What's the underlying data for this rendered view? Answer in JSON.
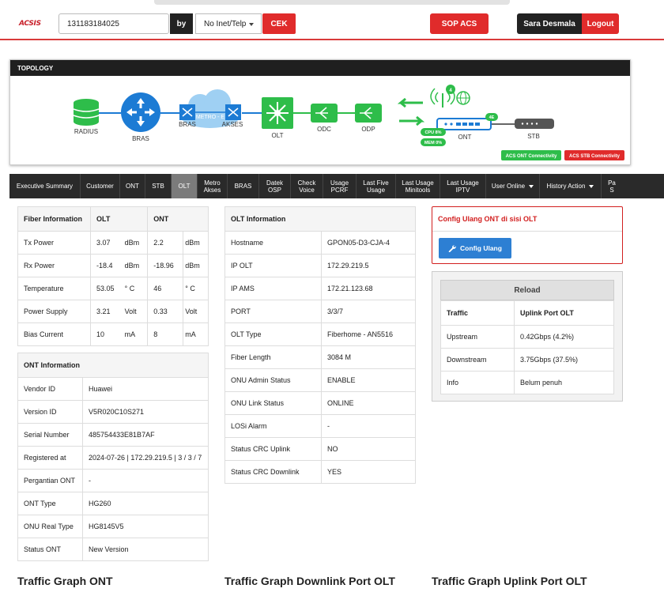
{
  "header": {
    "logo_text": "ACSIS",
    "search_value": "131183184025",
    "by_label": "by",
    "select_value": "No Inet/Telp",
    "cek_label": "CEK",
    "sop_label": "SOP ACS",
    "user_name": "Sara Desmala",
    "logout_label": "Logout"
  },
  "topology": {
    "title": "TOPOLOGY",
    "nodes": {
      "radius": "RADIUS",
      "bras": "BRAS",
      "bras2": "BRAS",
      "metro": "METRO - E",
      "akses": "AKSES",
      "olt": "OLT",
      "odc": "ODC",
      "odp": "ODP",
      "ont": "ONT",
      "stb": "STB"
    },
    "badges": {
      "wifi_count": "4",
      "ont_port": "4E",
      "cpu": "CPU 8%",
      "mem": "MEM 0%",
      "acs_ont": "ACS ONT Connectivity",
      "acs_stb": "ACS STB Connectivity"
    },
    "colors": {
      "green": "#2ebd4a",
      "blue": "#1c7bd4",
      "red": "#e02b2b"
    }
  },
  "tabs": [
    {
      "label": "Executive Summary"
    },
    {
      "label": "Customer"
    },
    {
      "label": "ONT"
    },
    {
      "label": "STB"
    },
    {
      "label": "OLT"
    },
    {
      "label": "Metro Akses"
    },
    {
      "label": "BRAS"
    },
    {
      "label": "Datek OSP"
    },
    {
      "label": "Check Voice"
    },
    {
      "label": "Usage PCRF"
    },
    {
      "label": "Last Five Usage"
    },
    {
      "label": "Last Usage Minitools"
    },
    {
      "label": "Last Usage IPTV"
    },
    {
      "label": "User Online"
    },
    {
      "label": "History Action"
    },
    {
      "label": "Pa S"
    }
  ],
  "fiber": {
    "headers": [
      "Fiber Information",
      "OLT",
      "ONT"
    ],
    "rows": [
      {
        "label": "Tx Power",
        "olt": "3.07",
        "olt_unit": "dBm",
        "ont": "2.2",
        "ont_unit": "dBm"
      },
      {
        "label": "Rx Power",
        "olt": "-18.4",
        "olt_unit": "dBm",
        "ont": "-18.96",
        "ont_unit": "dBm"
      },
      {
        "label": "Temperature",
        "olt": "53.05",
        "olt_unit": "° C",
        "ont": "46",
        "ont_unit": "° C"
      },
      {
        "label": "Power Supply",
        "olt": "3.21",
        "olt_unit": "Volt",
        "ont": "0.33",
        "ont_unit": "Volt"
      },
      {
        "label": "Bias Current",
        "olt": "10",
        "olt_unit": "mA",
        "ont": "8",
        "ont_unit": "mA"
      }
    ]
  },
  "ont_info": {
    "title": "ONT Information",
    "rows": [
      {
        "label": "Vendor ID",
        "value": "Huawei"
      },
      {
        "label": "Version ID",
        "value": "V5R020C10S271"
      },
      {
        "label": "Serial Number",
        "value": "485754433E81B7AF"
      },
      {
        "label": "Registered at",
        "value": "2024-07-26 | 172.29.219.5 | 3 / 3 / 7"
      },
      {
        "label": "Pergantian ONT",
        "value": "-"
      },
      {
        "label": "ONT Type",
        "value": "HG260"
      },
      {
        "label": "ONU Real Type",
        "value": "HG8145V5"
      },
      {
        "label": "Status ONT",
        "value": "New Version"
      }
    ]
  },
  "olt_info": {
    "title": "OLT Information",
    "rows": [
      {
        "label": "Hostname",
        "value": "GPON05-D3-CJA-4"
      },
      {
        "label": "IP OLT",
        "value": "172.29.219.5"
      },
      {
        "label": "IP AMS",
        "value": "172.21.123.68"
      },
      {
        "label": "PORT",
        "value": "3/3/7"
      },
      {
        "label": "OLT Type",
        "value": "Fiberhome - AN5516"
      },
      {
        "label": "Fiber Length",
        "value": "3084 M"
      },
      {
        "label": "ONU Admin Status",
        "value": "ENABLE"
      },
      {
        "label": "ONU Link Status",
        "value": "ONLINE"
      },
      {
        "label": "LOSi Alarm",
        "value": "-"
      },
      {
        "label": "Status CRC Uplink",
        "value": "NO"
      },
      {
        "label": "Status CRC Downlink",
        "value": "YES"
      }
    ]
  },
  "config": {
    "title": "Config Ulang ONT di sisi OLT",
    "button_label": "Config Ulang"
  },
  "reload": {
    "button_label": "Reload",
    "headers": [
      "Traffic",
      "Uplink Port OLT"
    ],
    "rows": [
      {
        "label": "Upstream",
        "value": "0.42Gbps (4.2%)"
      },
      {
        "label": "Downstream",
        "value": "3.75Gbps (37.5%)"
      },
      {
        "label": "Info",
        "value": "Belum penuh"
      }
    ]
  },
  "graphs": {
    "ont": "Traffic Graph ONT",
    "downlink": "Traffic Graph Downlink Port OLT",
    "uplink": "Traffic Graph Uplink Port OLT"
  }
}
